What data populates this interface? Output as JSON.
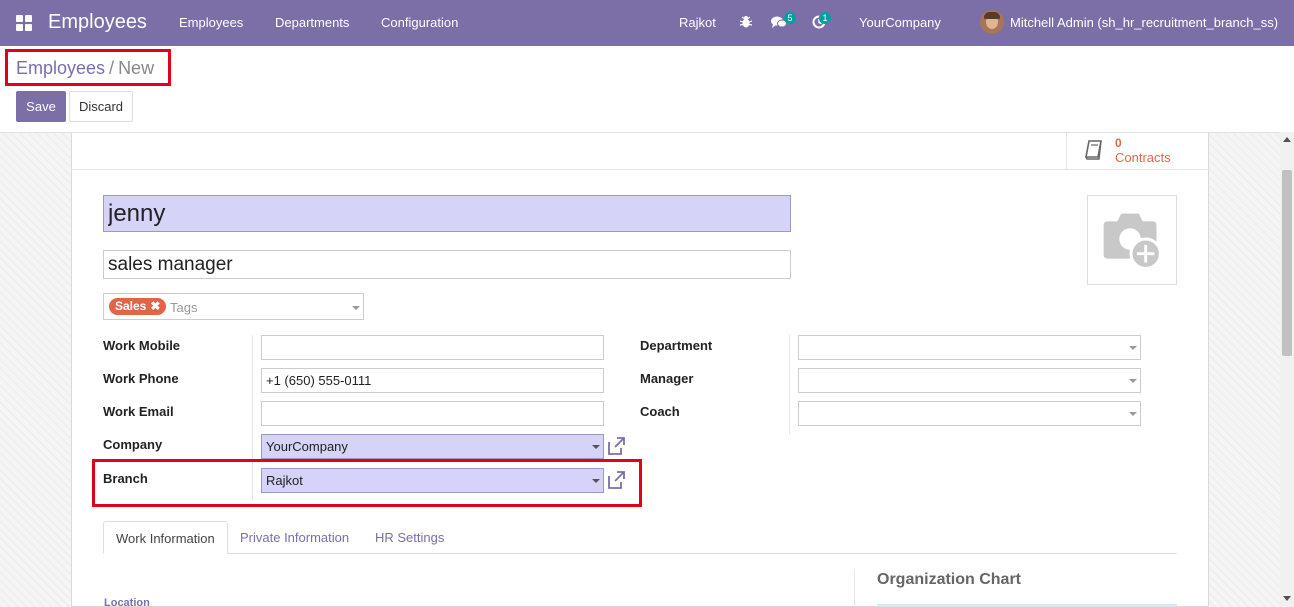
{
  "navbar": {
    "app_title": "Employees",
    "menu": [
      "Employees",
      "Departments",
      "Configuration"
    ],
    "branch": "Rajkot",
    "messages_count": "5",
    "activities_count": "1",
    "company": "YourCompany",
    "user": "Mitchell Admin (sh_hr_recruitment_branch_ss)",
    "color": "#7c6fa7"
  },
  "breadcrumb": {
    "parent": "Employees",
    "separator": "/",
    "current": "New"
  },
  "actions": {
    "save_label": "Save",
    "discard_label": "Discard"
  },
  "smart_button": {
    "count": "0",
    "label": "Contracts",
    "icon": "book-icon"
  },
  "employee": {
    "name": "jenny",
    "job_title": "sales manager",
    "tags": [
      "Sales"
    ],
    "tags_placeholder": "Tags"
  },
  "fields_left": [
    {
      "label": "Work Mobile",
      "value": ""
    },
    {
      "label": "Work Phone",
      "value": "+1 (650) 555-0111"
    },
    {
      "label": "Work Email",
      "value": ""
    },
    {
      "label": "Company",
      "value": "YourCompany"
    },
    {
      "label": "Branch",
      "value": "Rajkot"
    }
  ],
  "fields_right": [
    {
      "label": "Department",
      "value": ""
    },
    {
      "label": "Manager",
      "value": ""
    },
    {
      "label": "Coach",
      "value": ""
    }
  ],
  "tabs": [
    "Work Information",
    "Private Information",
    "HR Settings"
  ],
  "work_info": {
    "location_label": "Location",
    "org_chart_title": "Organization Chart"
  },
  "colors": {
    "required_field_bg": "#d5d3f8",
    "tag_bg": "#e2654a",
    "highlight_border": "#e3001b"
  }
}
